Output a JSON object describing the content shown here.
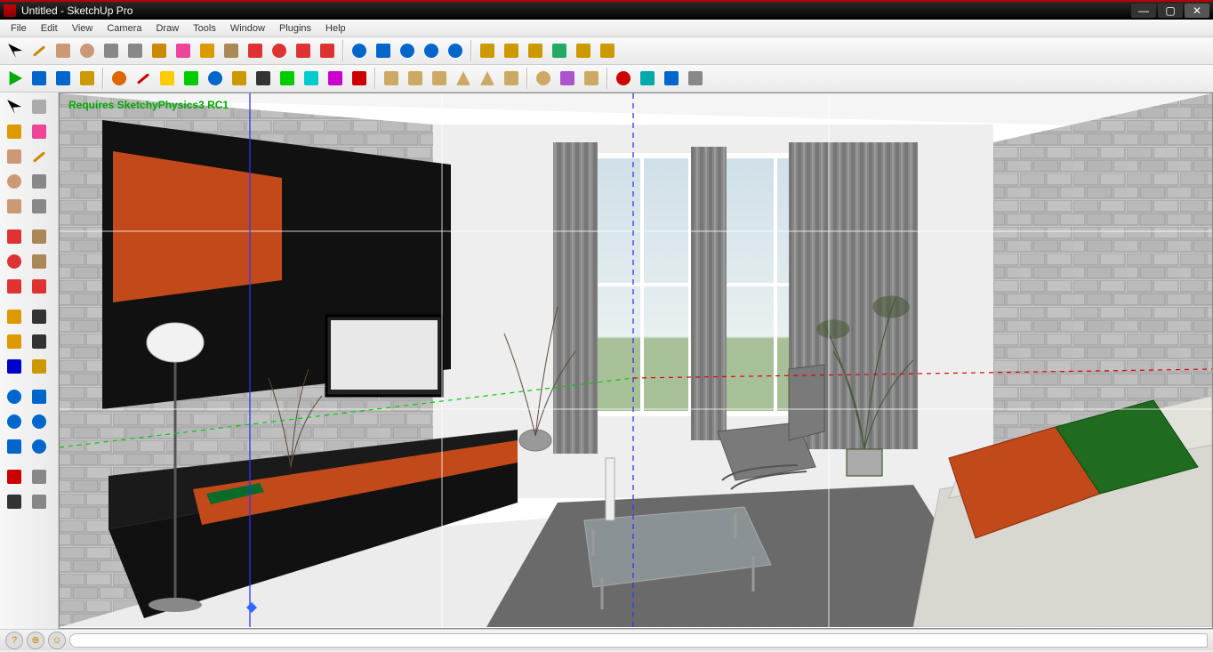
{
  "app_icon": "sketchup",
  "title": "Untitled - SketchUp Pro",
  "menus": [
    "File",
    "Edit",
    "View",
    "Camera",
    "Draw",
    "Tools",
    "Window",
    "Plugins",
    "Help"
  ],
  "viewport_note": "Requires SketchyPhysics3 RC1",
  "toolbar1": [
    {
      "name": "select-arrow",
      "c": "#000"
    },
    {
      "name": "pencil",
      "c": "#c80"
    },
    {
      "name": "rectangle",
      "c": "#c97"
    },
    {
      "name": "circle",
      "c": "#c97"
    },
    {
      "name": "arc",
      "c": "#888"
    },
    {
      "name": "freehand",
      "c": "#888"
    },
    {
      "name": "offset",
      "c": "#c80"
    },
    {
      "name": "eraser",
      "c": "#e49"
    },
    {
      "name": "paint-bucket",
      "c": "#d90"
    },
    {
      "name": "push-pull",
      "c": "#a85"
    },
    {
      "name": "move",
      "c": "#d33"
    },
    {
      "name": "rotate",
      "c": "#d33"
    },
    {
      "name": "scale",
      "c": "#d33"
    },
    {
      "name": "follow-me",
      "c": "#d33"
    },
    {
      "name": "sep"
    },
    {
      "name": "orbit",
      "c": "#06c"
    },
    {
      "name": "pan",
      "c": "#06c"
    },
    {
      "name": "zoom",
      "c": "#06c"
    },
    {
      "name": "zoom-window",
      "c": "#06c"
    },
    {
      "name": "zoom-extents",
      "c": "#06c"
    },
    {
      "name": "sep"
    },
    {
      "name": "get-models",
      "c": "#c90"
    },
    {
      "name": "share-model",
      "c": "#c90"
    },
    {
      "name": "upload",
      "c": "#c90"
    },
    {
      "name": "google-earth",
      "c": "#2a6"
    },
    {
      "name": "place-model",
      "c": "#c90"
    },
    {
      "name": "3d-warehouse",
      "c": "#c90"
    }
  ],
  "toolbar2": [
    {
      "name": "play",
      "c": "#0a0"
    },
    {
      "name": "rewind",
      "c": "#06c"
    },
    {
      "name": "ui-toggle",
      "c": "#06c"
    },
    {
      "name": "joint-settings",
      "c": "#c90"
    },
    {
      "name": "sep"
    },
    {
      "name": "refresh",
      "c": "#d60"
    },
    {
      "name": "pencil2",
      "c": "#c00"
    },
    {
      "name": "polygon",
      "c": "#fc0"
    },
    {
      "name": "tri",
      "c": "#0c0"
    },
    {
      "name": "circle2",
      "c": "#06c"
    },
    {
      "name": "hand",
      "c": "#c90"
    },
    {
      "name": "shade",
      "c": "#333"
    },
    {
      "name": "hull",
      "c": "#0c0"
    },
    {
      "name": "spring",
      "c": "#0cc"
    },
    {
      "name": "curve",
      "c": "#c0c"
    },
    {
      "name": "joint",
      "c": "#c00"
    },
    {
      "name": "sep"
    },
    {
      "name": "box",
      "c": "#ca6"
    },
    {
      "name": "cylinder",
      "c": "#ca6"
    },
    {
      "name": "cylinder2",
      "c": "#ca6"
    },
    {
      "name": "cone",
      "c": "#ca6"
    },
    {
      "name": "cone2",
      "c": "#ca6"
    },
    {
      "name": "floor",
      "c": "#ca6"
    },
    {
      "name": "sep"
    },
    {
      "name": "sphere",
      "c": "#ca6"
    },
    {
      "name": "blob",
      "c": "#a5c"
    },
    {
      "name": "pin",
      "c": "#ca6"
    },
    {
      "name": "sep"
    },
    {
      "name": "record",
      "c": "#c00"
    },
    {
      "name": "export",
      "c": "#0aa"
    },
    {
      "name": "first",
      "c": "#06c"
    },
    {
      "name": "prev",
      "c": "#888"
    }
  ],
  "sidetools": [
    {
      "name": "select",
      "c": "#000"
    },
    {
      "name": "component",
      "c": "#aaa"
    },
    {
      "name": "paint",
      "c": "#d90"
    },
    {
      "name": "eraser",
      "c": "#e49"
    },
    {
      "name": "rectangle",
      "c": "#c97"
    },
    {
      "name": "line",
      "c": "#c80"
    },
    {
      "name": "circle",
      "c": "#c97"
    },
    {
      "name": "arc",
      "c": "#888"
    },
    {
      "name": "polygon",
      "c": "#c97"
    },
    {
      "name": "freehand",
      "c": "#888"
    },
    {
      "name": "sep2"
    },
    {
      "name": "move",
      "c": "#d33"
    },
    {
      "name": "push-pull",
      "c": "#a85"
    },
    {
      "name": "rotate",
      "c": "#d33"
    },
    {
      "name": "follow-me",
      "c": "#a85"
    },
    {
      "name": "scale",
      "c": "#d33"
    },
    {
      "name": "offset",
      "c": "#d33"
    },
    {
      "name": "sep2"
    },
    {
      "name": "tape",
      "c": "#d90"
    },
    {
      "name": "dimension",
      "c": "#333"
    },
    {
      "name": "protractor",
      "c": "#d90"
    },
    {
      "name": "text",
      "c": "#333"
    },
    {
      "name": "axes",
      "c": "#00c"
    },
    {
      "name": "3d-text",
      "c": "#c90"
    },
    {
      "name": "sep2"
    },
    {
      "name": "orbit",
      "c": "#06c"
    },
    {
      "name": "pan",
      "c": "#06c"
    },
    {
      "name": "zoom",
      "c": "#06c"
    },
    {
      "name": "zoom-window",
      "c": "#06c"
    },
    {
      "name": "previous",
      "c": "#06c"
    },
    {
      "name": "zoom-extents",
      "c": "#06c"
    },
    {
      "name": "sep2"
    },
    {
      "name": "position-camera",
      "c": "#c00"
    },
    {
      "name": "look-around",
      "c": "#888"
    },
    {
      "name": "walk",
      "c": "#333"
    },
    {
      "name": "section",
      "c": "#888"
    }
  ],
  "status_icons": [
    "help",
    "geo",
    "person"
  ],
  "colors": {
    "orange": "#c24a1a",
    "black": "#111",
    "green": "#0a8a2a",
    "stone": "#bcbcbc",
    "sofa": "#d8d8d0",
    "pillow_g": "#1f6b1f"
  }
}
